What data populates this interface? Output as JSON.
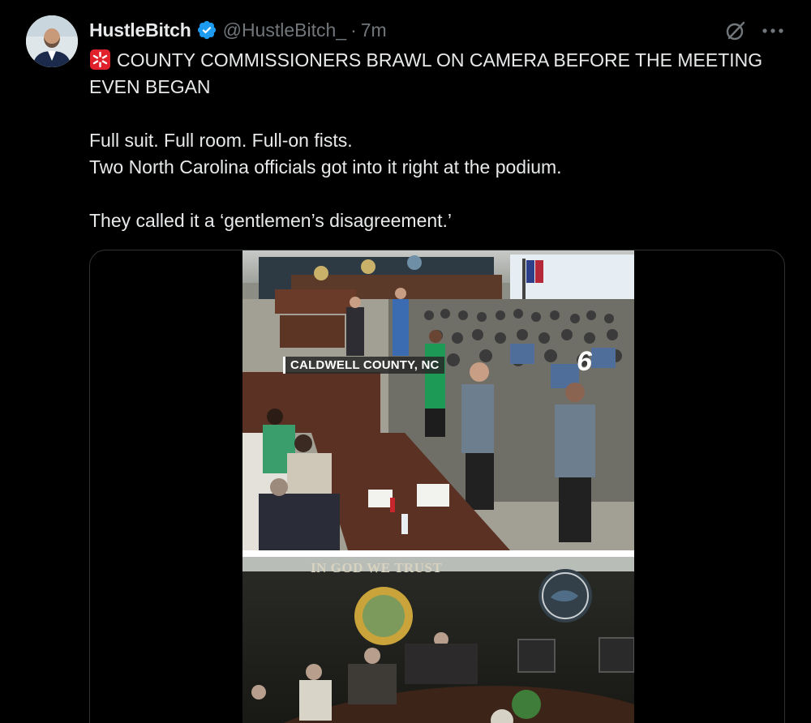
{
  "tweet": {
    "author": {
      "display_name": "HustleBitch",
      "handle": "@HustleBitch_",
      "verified": true,
      "verified_color": "#1d9bf0"
    },
    "separator": "·",
    "time": "7m",
    "icons": {
      "grok": "grok-icon",
      "more": "more-icon",
      "siren": "siren-emoji-icon"
    },
    "text": {
      "headline": "COUNTY COMMISSIONERS BRAWL ON CAMERA BEFORE THE MEETING EVEN BEGAN",
      "line1": "Full suit. Full room. Full-on fists.",
      "line2": "Two North Carolina officials got into it right at the podium.",
      "line3": "They called it a ‘gentlemen’s disagreement.’"
    },
    "media": {
      "chyron": "CALDWELL COUNTY, NC",
      "channel_logo": "6",
      "motto": "IN GOD WE TRUST"
    }
  }
}
